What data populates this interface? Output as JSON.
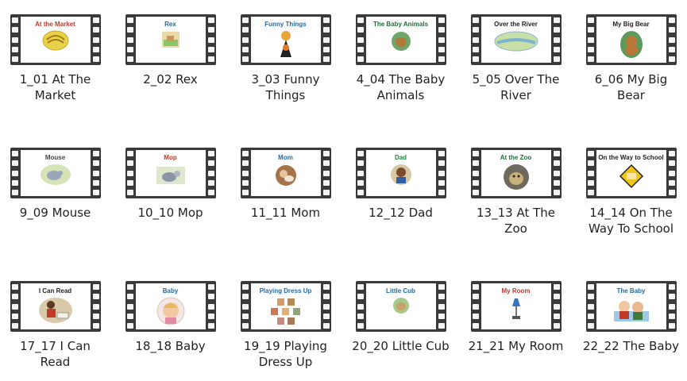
{
  "items": [
    {
      "caption": "1_01 At The Market",
      "cover_title": "At the Market",
      "title_color": "#c0392b",
      "art": "bananas"
    },
    {
      "caption": "2_02 Rex",
      "cover_title": "Rex",
      "title_color": "#2a6a8a",
      "art": "dog-yard"
    },
    {
      "caption": "3_03 Funny Things",
      "cover_title": "Funny Things",
      "title_color": "#1e6aa8",
      "art": "dog-costume"
    },
    {
      "caption": "4_04 The Baby Animals",
      "cover_title": "The Baby Animals",
      "title_color": "#1e6e3a",
      "art": "puppy"
    },
    {
      "caption": "5_05 Over The River",
      "cover_title": "Over the River",
      "title_color": "#222222",
      "art": "river"
    },
    {
      "caption": "6_06 My Big Bear",
      "cover_title": "My Big Bear",
      "title_color": "#222222",
      "art": "bear"
    },
    {
      "caption": "9_09 Mouse",
      "cover_title": "Mouse",
      "title_color": "#444444",
      "art": "mouse"
    },
    {
      "caption": "10_10 Mop",
      "cover_title": "Mop",
      "title_color": "#c0392b",
      "art": "mop"
    },
    {
      "caption": "11_11 Mom",
      "cover_title": "Mom",
      "title_color": "#1e6aa8",
      "art": "mom"
    },
    {
      "caption": "12_12 Dad",
      "cover_title": "Dad",
      "title_color": "#1e8a3a",
      "art": "dad"
    },
    {
      "caption": "13_13 At The Zoo",
      "cover_title": "At the Zoo",
      "title_color": "#1e6e3a",
      "art": "zoo"
    },
    {
      "caption": "14_14 On The Way To School",
      "cover_title": "On the Way to School",
      "title_color": "#222222",
      "art": "sign"
    },
    {
      "caption": "17_17 I Can Read",
      "cover_title": "I Can Read",
      "title_color": "#222222",
      "art": "reader"
    },
    {
      "caption": "18_18 Baby",
      "cover_title": "Baby",
      "title_color": "#1e6aa8",
      "art": "baby"
    },
    {
      "caption": "19_19 Playing Dress Up",
      "cover_title": "Playing Dress Up",
      "title_color": "#1e6aa8",
      "art": "dressup"
    },
    {
      "caption": "20_20 Little Cub",
      "cover_title": "Little Cub",
      "title_color": "#1e6aa8",
      "art": "cub"
    },
    {
      "caption": "21_21 My Room",
      "cover_title": "My Room",
      "title_color": "#c0392b",
      "art": "lamp"
    },
    {
      "caption": "22_22 The Baby",
      "cover_title": "The Baby",
      "title_color": "#1e6aa8",
      "art": "babies"
    }
  ]
}
